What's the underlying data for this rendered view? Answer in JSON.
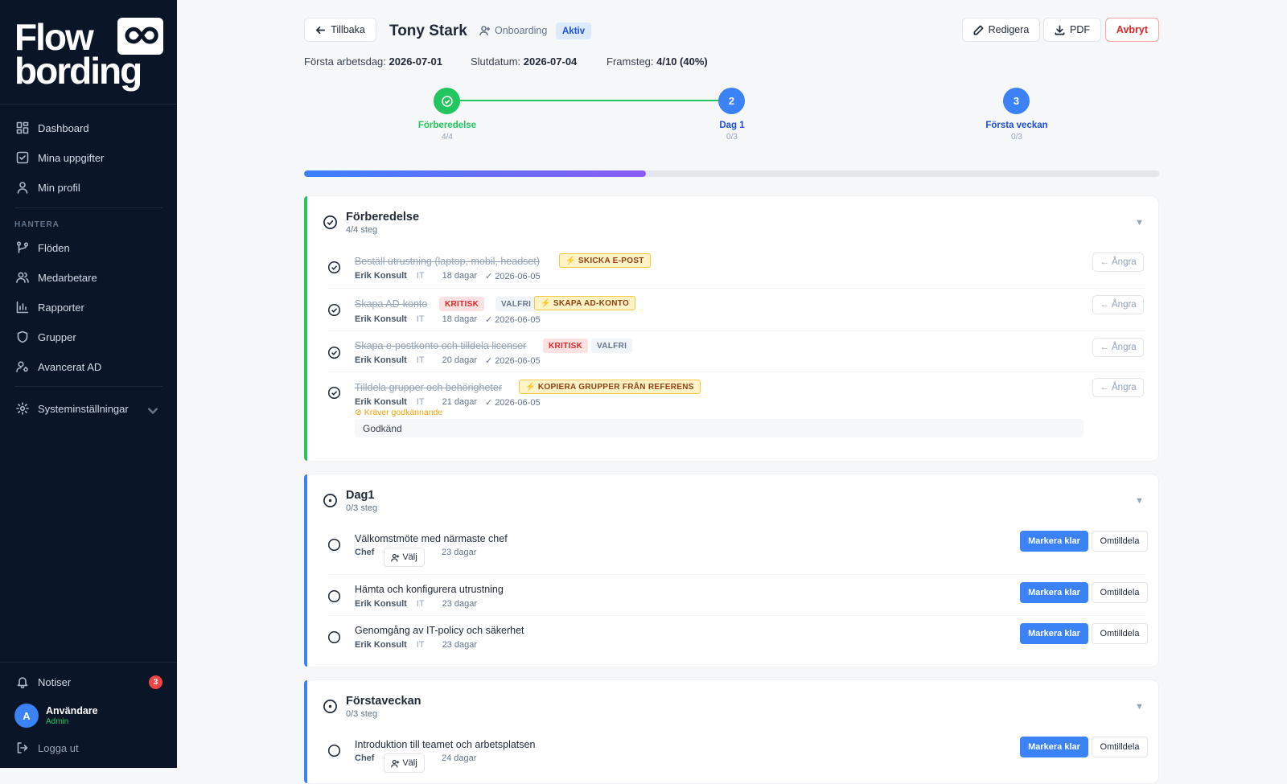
{
  "sidebar": {
    "logo_line1": "Flow",
    "logo_line2": "bording",
    "nav": [
      {
        "label": "Dashboard",
        "icon": "dashboard-icon"
      },
      {
        "label": "Mina uppgifter",
        "icon": "checkbox-icon"
      },
      {
        "label": "Min profil",
        "icon": "user-icon"
      }
    ],
    "section_label": "HANTERA",
    "manage": [
      {
        "label": "Flöden",
        "icon": "flow-icon"
      },
      {
        "label": "Medarbetare",
        "icon": "users-icon"
      },
      {
        "label": "Rapporter",
        "icon": "chart-icon"
      },
      {
        "label": "Grupper",
        "icon": "shield-icon"
      },
      {
        "label": "Avancerat AD",
        "icon": "user-key-icon"
      }
    ],
    "settings": "Systeminställningar",
    "notifications": "Notiser",
    "notification_count": "3",
    "user_initial": "A",
    "user_name": "Användare",
    "user_role": "Admin",
    "logout": "Logga ut"
  },
  "header": {
    "back": "Tillbaka",
    "name": "Tony Stark",
    "type": "Onboarding",
    "status": "Aktiv",
    "edit": "Redigera",
    "pdf": "PDF",
    "cancel": "Avbryt"
  },
  "meta": {
    "start_label": "Första arbetsdag:",
    "start": "2026-07-01",
    "end_label": "Slutdatum:",
    "end": "2026-07-04",
    "progress_label": "Framsteg:",
    "progress": "4/10 (40%)",
    "progress_fraction": 0.4
  },
  "stepper": [
    {
      "label": "Förberedelse",
      "count": "4/4",
      "state": "done",
      "num": ""
    },
    {
      "label": "Dag 1",
      "count": "0/3",
      "state": "active",
      "num": "2"
    },
    {
      "label": "Första veckan",
      "count": "0/3",
      "state": "active",
      "num": "3"
    }
  ],
  "phases": [
    {
      "title": "Förberedelse",
      "sub": "4/4 steg",
      "tasks": [
        {
          "name": "Beställ utrustning (laptop, mobil, headset)",
          "who": "Erik Konsult",
          "dept": "IT",
          "days": "18 dagar",
          "date": "✓ 2026-06-05",
          "auto": "SKICKA E-POST",
          "undo": "Ångra"
        },
        {
          "name": "Skapa AD-konto",
          "who": "Erik Konsult",
          "dept": "IT",
          "days": "18 dagar",
          "date": "✓ 2026-06-05",
          "krit": "KRITISK",
          "valfri": "VALFRI",
          "auto": "SKAPA AD-KONTO",
          "undo": "Ångra"
        },
        {
          "name": "Skapa e-postkonto och tilldela licenser",
          "who": "Erik Konsult",
          "dept": "IT",
          "days": "20 dagar",
          "date": "✓ 2026-06-05",
          "krit": "KRITISK",
          "valfri": "VALFRI",
          "undo": "Ångra"
        },
        {
          "name": "Tilldela grupper och behörigheter",
          "who": "Erik Konsult",
          "dept": "IT",
          "days": "21 dagar",
          "date": "✓ 2026-06-05",
          "auto": "KOPIERA GRUPPER FRÅN REFERENS",
          "approval": "Kräver godkännande",
          "approved": "Godkänd",
          "undo": "Ångra"
        }
      ]
    },
    {
      "title": "Dag1",
      "sub": "0/3 steg",
      "tasks": [
        {
          "name": "Välkomstmöte med närmaste chef",
          "who": "Chef",
          "choose": "Välj",
          "days": "23 dagar"
        },
        {
          "name": "Hämta och konfigurera utrustning",
          "who": "Erik Konsult",
          "dept": "IT",
          "days": "23 dagar"
        },
        {
          "name": "Genomgång av IT-policy och säkerhet",
          "who": "Erik Konsult",
          "dept": "IT",
          "days": "23 dagar"
        }
      ]
    },
    {
      "title": "Förstaveckan",
      "sub": "0/3 steg",
      "tasks": [
        {
          "name": "Introduktion till teamet och arbetsplatsen",
          "who": "Chef",
          "choose": "Välj",
          "days": "24 dagar"
        }
      ]
    }
  ],
  "actions": {
    "mark_done": "Markera klar",
    "reassign": "Omtilldela"
  },
  "colors": {
    "sidebar_bg": "#0b1528",
    "accent": "#3b82f6",
    "success": "#22c55e",
    "danger": "#dc2626"
  }
}
